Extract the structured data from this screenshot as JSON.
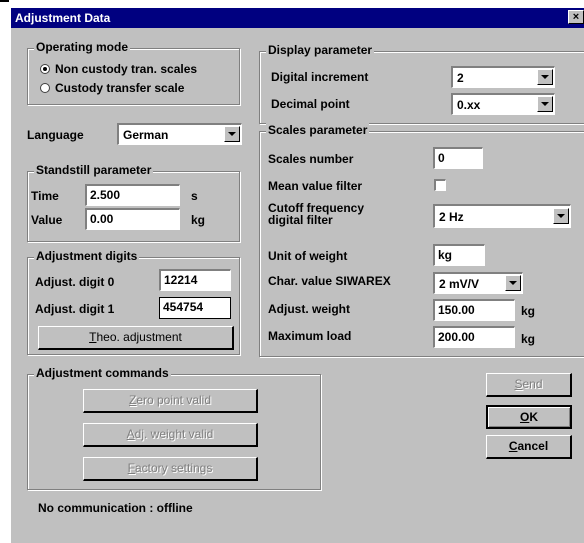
{
  "window": {
    "title": "Adjustment Data",
    "close_glyph": "×"
  },
  "operating_mode": {
    "legend": "Operating mode",
    "options": [
      {
        "label": "Non custody tran. scales",
        "selected": true
      },
      {
        "label": "Custody transfer scale",
        "selected": false
      }
    ]
  },
  "language": {
    "label": "Language",
    "value": "German"
  },
  "standstill": {
    "legend": "Standstill parameter",
    "time_label": "Time",
    "time_value": "2.500",
    "time_unit": "s",
    "value_label": "Value",
    "value_value": "0.00",
    "value_unit": "kg"
  },
  "adjustment_digits": {
    "legend": "Adjustment digits",
    "digit0_label": "Adjust. digit 0",
    "digit0_value": "12214",
    "digit1_label": "Adjust. digit 1",
    "digit1_value": "454754",
    "theo_button_mnemonic": "T",
    "theo_button_rest": "heo. adjustment"
  },
  "display_parameter": {
    "legend": "Display parameter",
    "digital_increment_label": "Digital increment",
    "digital_increment_value": "2",
    "decimal_point_label": "Decimal point",
    "decimal_point_value": "0.xx"
  },
  "scales_parameter": {
    "legend": "Scales parameter",
    "scales_number_label": "Scales number",
    "scales_number_value": "0",
    "mean_value_filter_label": "Mean value filter",
    "mean_value_filter_checked": false,
    "cutoff_label_line1": "Cutoff frequency",
    "cutoff_label_line2": "digital filter",
    "cutoff_value": "2 Hz",
    "unit_of_weight_label": "Unit of weight",
    "unit_of_weight_value": "kg",
    "char_value_label": "Char. value SIWAREX",
    "char_value_value": "2 mV/V",
    "adjust_weight_label": "Adjust. weight",
    "adjust_weight_value": "150.00",
    "adjust_weight_unit": "kg",
    "max_load_label": "Maximum load",
    "max_load_value": "200.00",
    "max_load_unit": "kg"
  },
  "adjustment_commands": {
    "legend": "Adjustment commands",
    "zero_mnemonic": "Z",
    "zero_rest": "ero point valid",
    "adj_mnemonic": "A",
    "adj_rest": "dj. weight valid",
    "factory_mnemonic": "F",
    "factory_rest": "actory settings"
  },
  "buttons": {
    "send_mnemonic": "S",
    "send_rest": "end",
    "ok_mnemonic": "O",
    "ok_rest": "K",
    "cancel_mnemonic": "C",
    "cancel_rest": "ancel"
  },
  "status": {
    "text": "No communication : offline"
  }
}
